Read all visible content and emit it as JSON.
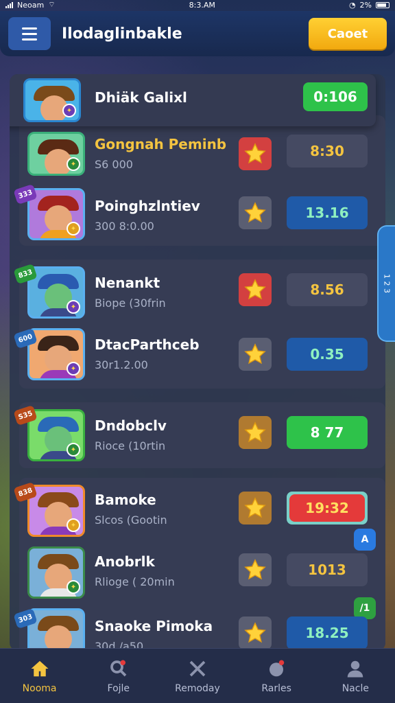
{
  "status_bar": {
    "carrier": "Neoam",
    "time": "8:3.AM",
    "battery": "2%"
  },
  "header": {
    "title": "Ilodaglinbakle",
    "cta_label": "Caoet"
  },
  "side_tab": {
    "label": "1 2 3"
  },
  "rows": [
    {
      "name": "Dhiäk Galixl",
      "sub": "",
      "value": "0:106",
      "value_style": "green",
      "star_bg": "",
      "tag": ""
    },
    {
      "name": "Gongnah Peminb",
      "sub": "S6 000",
      "value": "8:30",
      "value_style": "grey",
      "star_bg": "#d34040",
      "tag": ""
    },
    {
      "name": "Poinghzlntiev",
      "sub": "300 8:0.00",
      "value": "13.16",
      "value_style": "blue",
      "star_bg": "#5a5e72",
      "tag": "333"
    },
    {
      "name": "Nenankt",
      "sub": "Biope (30frin",
      "value": "8.56",
      "value_style": "grey",
      "star_bg": "#d34040",
      "tag": "833"
    },
    {
      "name": "DtacParthceb",
      "sub": "30r1.2.00",
      "value": "0.35",
      "value_style": "blue",
      "star_bg": "#5a5e72",
      "tag": "600"
    },
    {
      "name": "Dndobclv",
      "sub": "Rioce (10rtin",
      "value": "8 77",
      "value_style": "green",
      "star_bg": "#5a5e72",
      "tag": "S35"
    },
    {
      "name": "Bamoke",
      "sub": "Slcos (Gootin",
      "value": "19:32",
      "value_style": "red",
      "star_bg": "#5a5e72",
      "tag": "838"
    },
    {
      "name": "Anobrlk",
      "sub": "Rlioge ( 20min",
      "value": "1013",
      "value_style": "grey",
      "star_bg": "#5a5e72",
      "tag": ""
    },
    {
      "name": "Snaoke Pimoka",
      "sub": "30d /a50",
      "value": "18.25",
      "value_style": "blue",
      "star_bg": "#5a5e72",
      "tag": "303"
    }
  ],
  "mini_badges": [
    {
      "label": "A"
    },
    {
      "label": "/1"
    }
  ],
  "nav": [
    {
      "label": "Nooma",
      "icon": "home-icon",
      "active": true
    },
    {
      "label": "Fojle",
      "icon": "search-icon",
      "active": false
    },
    {
      "label": "Remoday",
      "icon": "tools-icon",
      "active": false
    },
    {
      "label": "Rarles",
      "icon": "face-icon",
      "active": false
    },
    {
      "label": "Nacle",
      "icon": "user-icon",
      "active": false
    }
  ],
  "colors": {
    "accent_gold": "#f4c440",
    "header_bg": "#1d3566",
    "panel_bg": "#2c364e",
    "green": "#2ec24a",
    "blue": "#1f5aa8",
    "red": "#e43a3a"
  }
}
